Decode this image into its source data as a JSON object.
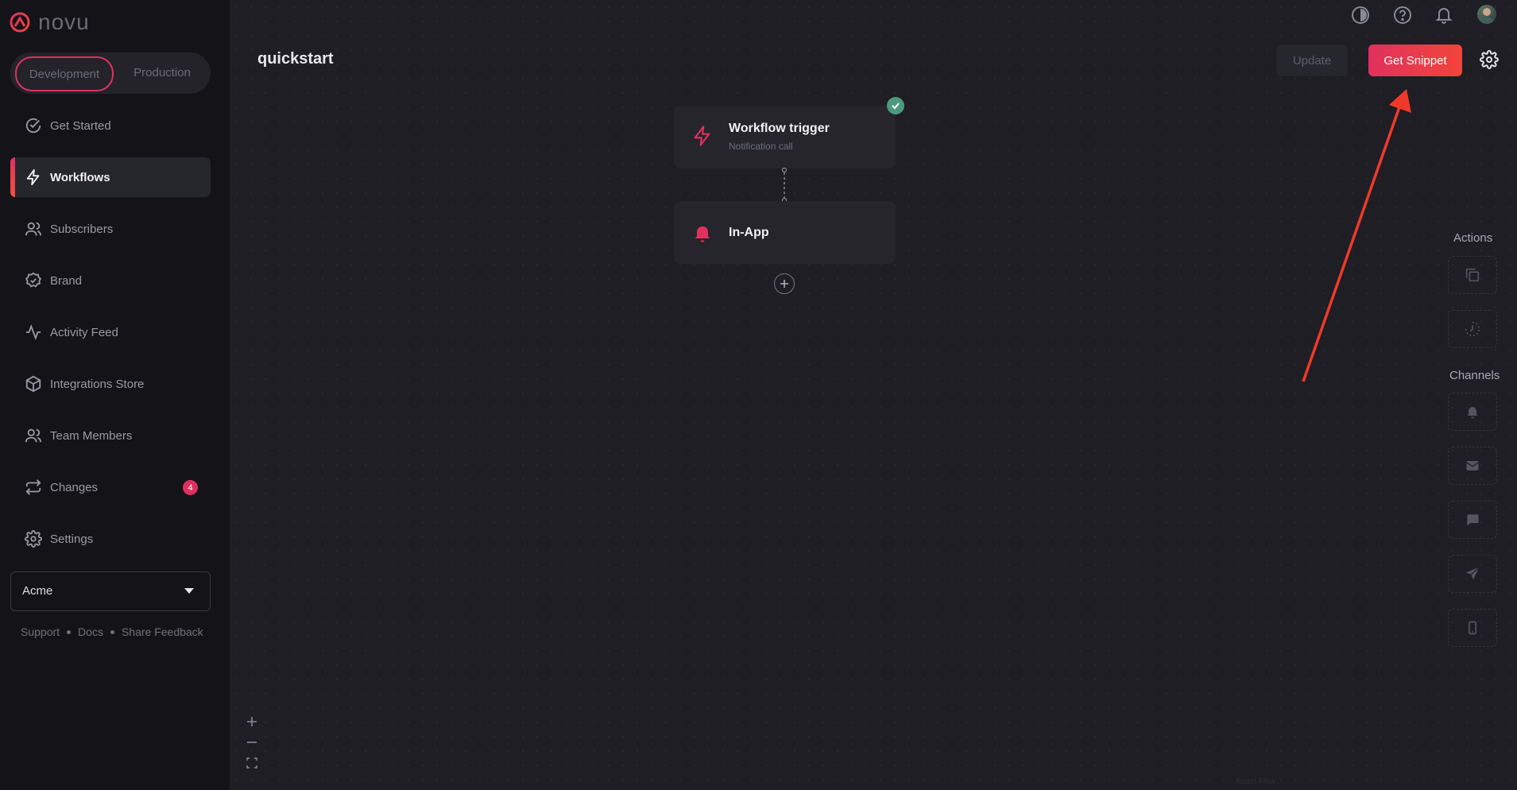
{
  "app": {
    "logo_text": "novu"
  },
  "environment": {
    "development": "Development",
    "production": "Production",
    "active": "Development"
  },
  "sidebar": {
    "items": [
      {
        "label": "Get Started",
        "icon": "check-circle-icon"
      },
      {
        "label": "Workflows",
        "icon": "bolt-icon",
        "active": true
      },
      {
        "label": "Subscribers",
        "icon": "users-icon"
      },
      {
        "label": "Brand",
        "icon": "badge-check-icon"
      },
      {
        "label": "Activity Feed",
        "icon": "activity-icon"
      },
      {
        "label": "Integrations Store",
        "icon": "box-icon"
      },
      {
        "label": "Team Members",
        "icon": "team-icon"
      },
      {
        "label": "Changes",
        "icon": "repeat-icon",
        "badge": "4"
      },
      {
        "label": "Settings",
        "icon": "gear-icon"
      }
    ],
    "organization": "Acme",
    "footer": [
      "Support",
      "Docs",
      "Share Feedback"
    ]
  },
  "header": {
    "title": "quickstart",
    "update_label": "Update",
    "snippet_label": "Get Snippet",
    "icons": [
      "theme-toggle-icon",
      "help-icon",
      "bell-icon",
      "avatar"
    ]
  },
  "workflow": {
    "trigger": {
      "title": "Workflow trigger",
      "subtitle": "Notification call"
    },
    "steps": [
      {
        "title": "In-App",
        "icon": "bell-icon"
      }
    ]
  },
  "side_panel": {
    "actions_title": "Actions",
    "actions": [
      "copy-icon",
      "delay-icon"
    ],
    "channels_title": "Channels",
    "channels": [
      "in-app-bell-icon",
      "email-icon",
      "chat-icon",
      "push-icon",
      "sms-icon"
    ]
  },
  "canvas": {
    "attribution": "React Flow"
  },
  "colors": {
    "accent": "#e0315e",
    "accent_end": "#f1453b",
    "success": "#4d9980",
    "annotation_arrow": "#f0392b"
  }
}
